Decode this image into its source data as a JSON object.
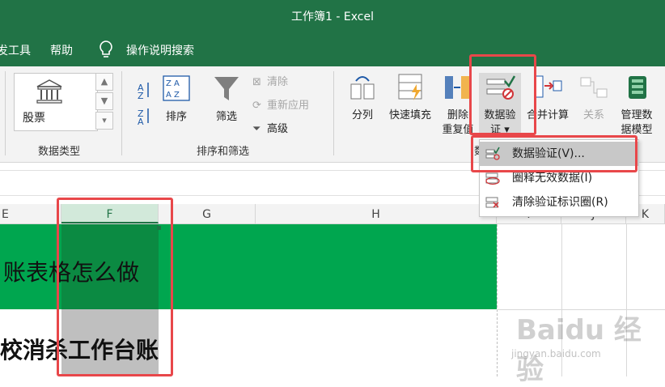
{
  "window": {
    "title": "工作簿1 - Excel"
  },
  "menu": {
    "tab_dev": "发工具",
    "tab_help": "帮助",
    "tell_me": "操作说明搜索"
  },
  "ribbon": {
    "data_types": {
      "gallery_item": "股票",
      "group": "数据类型"
    },
    "sort_filter": {
      "sort": "排序",
      "filter": "筛选",
      "clear": "清除",
      "reapply": "重新应用",
      "advanced": "高级",
      "group": "排序和筛选"
    },
    "data_tools": {
      "text_to_columns": "分列",
      "flash_fill": "快速填充",
      "remove_dup_1": "删除",
      "remove_dup_2": "重复值",
      "validation_1": "数据验",
      "validation_2": "证 ▾",
      "consolidate": "合并计算",
      "relationships": "关系",
      "data_model_1": "管理数",
      "data_model_2": "据模型",
      "group_partial": "数"
    }
  },
  "dropdown": {
    "items": [
      {
        "label": "数据验证(V)...",
        "icon": "data-validation-icon"
      },
      {
        "label": "圈释无效数据(I)",
        "icon": "circle-invalid-icon"
      },
      {
        "label": "清除验证标识圈(R)",
        "icon": "clear-circles-icon"
      }
    ]
  },
  "columns": [
    "E",
    "F",
    "G",
    "H",
    "I",
    "J",
    "K"
  ],
  "cells": {
    "row1_text": "账表格怎么做",
    "row2_text": "校消杀工作台账"
  },
  "watermark": {
    "main": "Baidu 经验",
    "sub": "jingyan.baidu.com"
  },
  "colors": {
    "excel_green": "#217346",
    "sheet_green": "#00a64f",
    "highlight_red": "#e8474a"
  }
}
